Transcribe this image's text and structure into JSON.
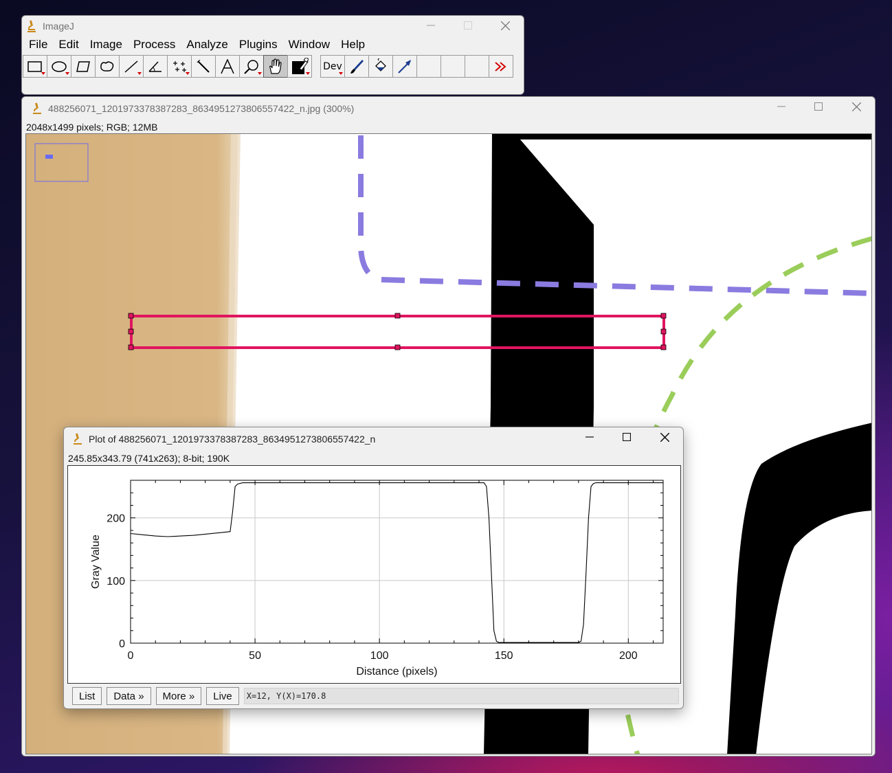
{
  "main_window": {
    "title": "ImageJ",
    "menus": [
      "File",
      "Edit",
      "Image",
      "Process",
      "Analyze",
      "Plugins",
      "Window",
      "Help"
    ],
    "tools": [
      {
        "name": "rectangle-tool-icon",
        "selected": false,
        "has_menu": true
      },
      {
        "name": "oval-tool-icon",
        "selected": false,
        "has_menu": true
      },
      {
        "name": "polygon-tool-icon",
        "selected": false,
        "has_menu": false
      },
      {
        "name": "freehand-tool-icon",
        "selected": false,
        "has_menu": false
      },
      {
        "name": "straight-line-tool-icon",
        "selected": false,
        "has_menu": true
      },
      {
        "name": "angle-tool-icon",
        "selected": false,
        "has_menu": false
      },
      {
        "name": "multi-point-tool-icon",
        "selected": false,
        "has_menu": true
      },
      {
        "name": "wand-tool-icon",
        "selected": false,
        "has_menu": false
      },
      {
        "name": "text-tool-icon",
        "selected": false,
        "has_menu": false
      },
      {
        "name": "magnifying-glass-tool-icon",
        "selected": false,
        "has_menu": true
      },
      {
        "name": "hand-tool-icon",
        "selected": true,
        "has_menu": false
      },
      {
        "name": "color-picker-tool-icon",
        "selected": false,
        "has_menu": true
      },
      {
        "name": "developer-menu-icon",
        "selected": false,
        "has_menu": true,
        "label": "Dev"
      },
      {
        "name": "brush-tool-icon",
        "selected": false,
        "has_menu": false
      },
      {
        "name": "flood-filler-tool-icon",
        "selected": false,
        "has_menu": false
      },
      {
        "name": "arrow-tool-icon",
        "selected": false,
        "has_menu": false
      },
      {
        "name": "empty-tool-slot-1",
        "selected": false,
        "has_menu": false
      },
      {
        "name": "empty-tool-slot-2",
        "selected": false,
        "has_menu": false
      },
      {
        "name": "empty-tool-slot-3",
        "selected": false,
        "has_menu": false
      },
      {
        "name": "more-tools-icon",
        "selected": false,
        "has_menu": false
      }
    ]
  },
  "image_window": {
    "title": "488256071_1201973378387283_8634951273806557422_n.jpg (300%)",
    "info": "2048x1499 pixels; RGB; 12MB",
    "colors": {
      "tan": "#d6b381",
      "black": "#000000",
      "purple_dash": "#8a7be0",
      "green_dash": "#9acd5a",
      "roi": "#e0155f"
    }
  },
  "plot_window": {
    "title": "Plot of 488256071_1201973378387283_8634951273806557422_n",
    "info": "245.85x343.79  (741x263); 8-bit; 190K",
    "buttons": {
      "list": "List",
      "data": "Data »",
      "more": "More »",
      "live": "Live"
    },
    "status": "X=12, Y(X)=170.8"
  },
  "chart_data": {
    "type": "line",
    "xlabel": "Distance (pixels)",
    "ylabel": "Gray Value",
    "xlim": [
      0,
      214
    ],
    "ylim": [
      0,
      260
    ],
    "x_ticks": [
      0,
      50,
      100,
      150,
      200
    ],
    "y_ticks": [
      0,
      100,
      200
    ],
    "grid": true,
    "series": [
      {
        "x": [
          0,
          5,
          10,
          15,
          20,
          25,
          30,
          35,
          40,
          41,
          42,
          43,
          45,
          48,
          50,
          60,
          80,
          100,
          120,
          140,
          142,
          143,
          144,
          145,
          146,
          147,
          148,
          149,
          150,
          170,
          180,
          181,
          182,
          183,
          184,
          185,
          186,
          187,
          190,
          200,
          214
        ],
        "y": [
          175,
          173,
          171,
          170,
          171,
          172,
          174,
          176,
          178,
          210,
          250,
          254,
          256,
          256,
          256,
          256,
          256,
          256,
          256,
          256,
          256,
          250,
          200,
          110,
          20,
          3,
          1,
          1,
          1,
          1,
          1,
          3,
          30,
          110,
          200,
          250,
          255,
          256,
          256,
          256,
          256
        ]
      }
    ]
  }
}
